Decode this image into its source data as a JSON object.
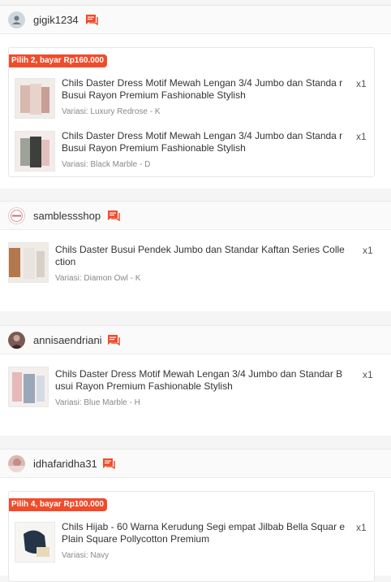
{
  "shops": [
    {
      "name": "gigik1234",
      "promo": "Pilih 2, bayar Rp160.000",
      "items": [
        {
          "title": "Chils Daster Dress Motif Mewah Lengan 3/4 Jumbo dan Standa r Busui Rayon Premium Fashionable Stylish",
          "qty": "x1",
          "variant": "Variasi: Luxury Redrose - K"
        },
        {
          "title": "Chils Daster Dress Motif Mewah Lengan 3/4 Jumbo dan Standa r Busui Rayon Premium Fashionable Stylish",
          "qty": "x1",
          "variant": "Variasi: Black Marble - D"
        }
      ]
    },
    {
      "name": "samblessshop",
      "items": [
        {
          "title": "Chils Daster Busui Pendek Jumbo dan Standar Kaftan Series Colle ction",
          "qty": "x1",
          "variant": "Variasi: Diamon Owl - K"
        }
      ]
    },
    {
      "name": "annisaendriani",
      "items": [
        {
          "title": "Chils Daster Dress Motif Mewah Lengan 3/4 Jumbo dan Standar B usui Rayon Premium Fashionable Stylish",
          "qty": "x1",
          "variant": "Variasi: Blue Marble - H"
        }
      ]
    },
    {
      "name": "idhafaridha31",
      "promo": "Pilih 4, bayar Rp100.000",
      "items": [
        {
          "title": "Chils Hijab - 60 Warna Kerudung Segi empat Jilbab Bella Squar e Plain Square Pollycotton Premium",
          "qty": "x1",
          "variant": "Variasi: Navy"
        }
      ]
    }
  ],
  "colors": {
    "accent": "#ee4d2d"
  }
}
